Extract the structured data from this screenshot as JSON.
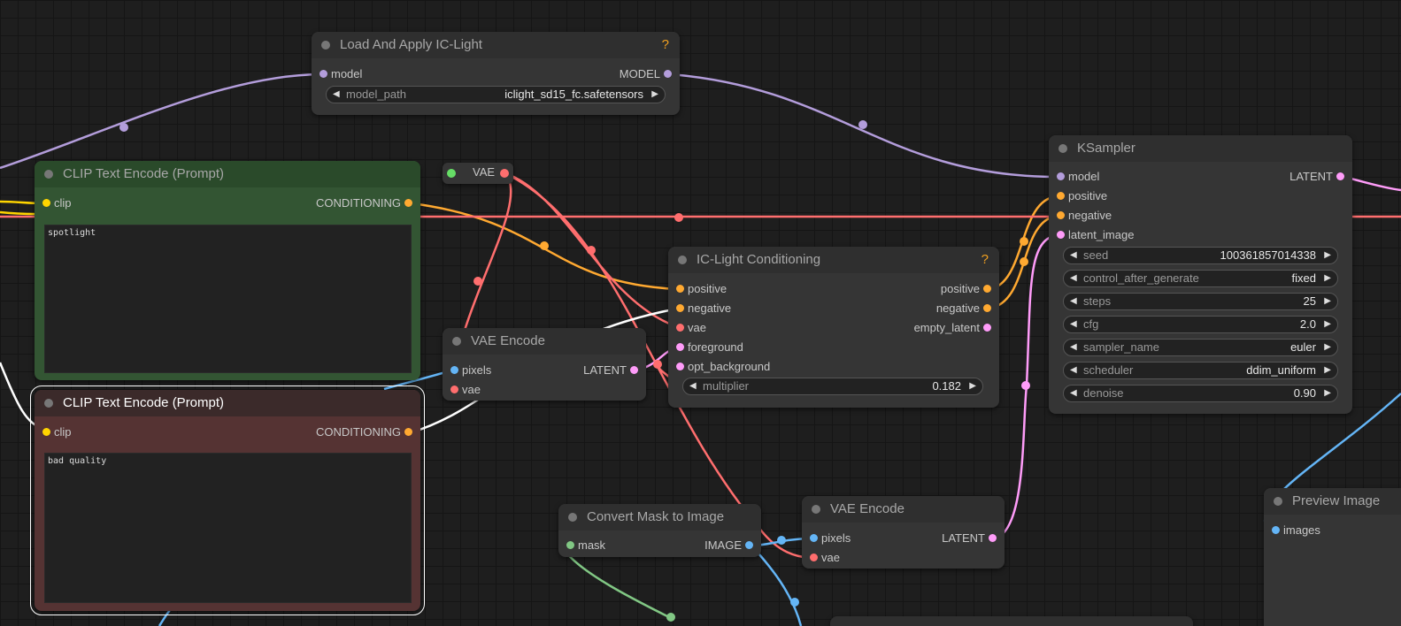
{
  "nodes": {
    "load_iclight": {
      "title": "Load And Apply IC-Light",
      "help": "?",
      "input_model": "model",
      "output_model": "MODEL",
      "model_path_label": "model_path",
      "model_path_value": "iclight_sd15_fc.safetensors"
    },
    "clip_pos": {
      "title": "CLIP Text Encode (Prompt)",
      "input_clip": "clip",
      "output_conditioning": "CONDITIONING",
      "text": "spotlight"
    },
    "clip_neg": {
      "title": "CLIP Text Encode (Prompt)",
      "input_clip": "clip",
      "output_conditioning": "CONDITIONING",
      "text": "bad quality"
    },
    "vae_reroute": {
      "label": "VAE"
    },
    "vae_encode_1": {
      "title": "VAE Encode",
      "input_pixels": "pixels",
      "input_vae": "vae",
      "output_latent": "LATENT"
    },
    "iclight_cond": {
      "title": "IC-Light Conditioning",
      "help": "?",
      "inputs": [
        "positive",
        "negative",
        "vae",
        "foreground",
        "opt_background"
      ],
      "outputs": [
        "positive",
        "negative",
        "empty_latent"
      ],
      "multiplier_label": "multiplier",
      "multiplier_value": "0.182"
    },
    "ksampler": {
      "title": "KSampler",
      "inputs": [
        "model",
        "positive",
        "negative",
        "latent_image"
      ],
      "output_latent": "LATENT",
      "widgets": [
        {
          "label": "seed",
          "value": "100361857014338"
        },
        {
          "label": "control_after_generate",
          "value": "fixed"
        },
        {
          "label": "steps",
          "value": "25"
        },
        {
          "label": "cfg",
          "value": "2.0"
        },
        {
          "label": "sampler_name",
          "value": "euler"
        },
        {
          "label": "scheduler",
          "value": "ddim_uniform"
        },
        {
          "label": "denoise",
          "value": "0.90"
        }
      ]
    },
    "convert_mask": {
      "title": "Convert Mask to Image",
      "input_mask": "mask",
      "output_image": "IMAGE"
    },
    "vae_encode_2": {
      "title": "VAE Encode",
      "input_pixels": "pixels",
      "input_vae": "vae",
      "output_latent": "LATENT"
    },
    "preview_image": {
      "title": "Preview Image",
      "input_images": "images"
    }
  },
  "colors": {
    "background": "#1e1e1e",
    "node_body": "#353535",
    "node_title": "#2f2f2f",
    "model": "#b39ddb",
    "clip": "#ffd500",
    "conditioning": "#ffa931",
    "vae": "#ff6e6e",
    "latent": "#ff9cf9",
    "image": "#64b5f6",
    "mask": "#81c784",
    "positive_node": "#335533",
    "negative_node": "#553333"
  },
  "icons": {
    "widget_left": "◀",
    "widget_right": "▶"
  }
}
